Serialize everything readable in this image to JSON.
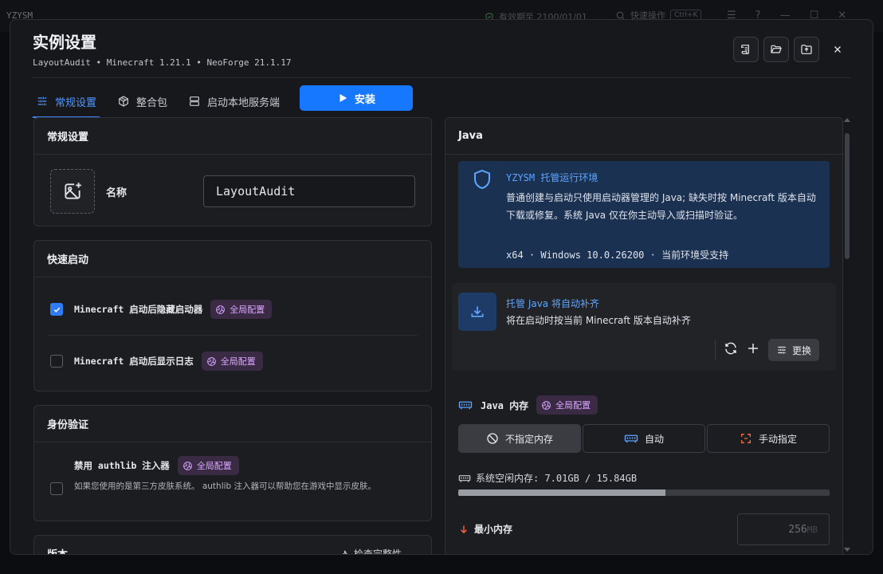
{
  "app": {
    "brand": "YZYSM",
    "validity": "有效期至 2100/01/01",
    "search": "快速操作",
    "shortcut": "Ctrl+K"
  },
  "dialog": {
    "title": "实例设置",
    "subtitle": "LayoutAudit • Minecraft 1.21.1 • NeoForge 21.1.17",
    "tabs": [
      {
        "label": "常规设置",
        "icon": "sliders-icon"
      },
      {
        "label": "整合包",
        "icon": "package-icon"
      },
      {
        "label": "启动本地服务端",
        "icon": "server-icon"
      }
    ],
    "install_label": "安装"
  },
  "general": {
    "title": "常规设置",
    "name_label": "名称",
    "name_value": "LayoutAudit"
  },
  "quick": {
    "title": "快速启动",
    "items": [
      {
        "label": "Minecraft 启动后隐藏启动器",
        "badge": "全局配置",
        "checked": true
      },
      {
        "label": "Minecraft 启动后显示日志",
        "badge": "全局配置",
        "checked": false
      }
    ]
  },
  "auth": {
    "title": "身份验证",
    "label": "禁用 authlib 注入器",
    "badge": "全局配置",
    "desc": "如果您使用的是第三方皮肤系统。 authlib 注入器可以帮助您在游戏中显示皮肤。"
  },
  "version": {
    "title": "版本",
    "check": "检查完整性"
  },
  "java": {
    "title": "Java",
    "info": {
      "title": "YZYSM 托管运行环境",
      "body": "普通创建与启动只使用启动器管理的 Java; 缺失时按 Minecraft 版本自动下载或修复。系统 Java 仅在你主动导入或扫描时验证。",
      "footer": "x64 · Windows 10.0.26200 · 当前环境受支持"
    },
    "managed": {
      "title": "托管 Java 将自动补齐",
      "body": "将在启动时按当前 Minecraft 版本自动补齐",
      "change_label": "更换"
    },
    "memory": {
      "title": "Java 内存",
      "badge": "全局配置",
      "modes": [
        "不指定内存",
        "自动",
        "手动指定"
      ],
      "system_free": "系统空闲内存: 7.01GB / 15.84GB",
      "used_fraction": 0.557,
      "min_label": "最小内存",
      "min_value": "256",
      "min_unit": "MB"
    }
  },
  "colors": {
    "accent": "#1677ff",
    "badge_bg": "#3a2a44",
    "badge_fg": "#d9a7ff",
    "info_bg": "#1b3152"
  }
}
